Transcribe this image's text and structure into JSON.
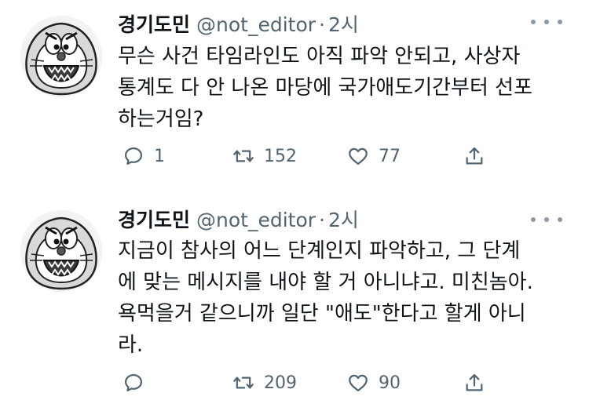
{
  "tweets": [
    {
      "display_name": "경기도민",
      "handle": "@not_editor",
      "separator": "·",
      "time": "2시",
      "lines": [
        "무슨 사건 타임라인도 아직 파악 안되고, 사상자",
        "통계도 다 안 나온 마당에 국가애도기간부터 선포",
        "하는거임?"
      ],
      "replies": "1",
      "retweets": "152",
      "likes": "77"
    },
    {
      "display_name": "경기도민",
      "handle": "@not_editor",
      "separator": "·",
      "time": "2시",
      "lines": [
        "지금이 참사의 어느 단계인지 파악하고, 그 단계",
        "에 맞는 메시지를 내야 할 거 아니냐고. 미친놈아.",
        "욕먹을거 같으니까 일단 \"애도\"한다고 할게 아니",
        "라."
      ],
      "replies": "",
      "retweets": "209",
      "likes": "90"
    }
  ],
  "icons": {
    "avatar": "doraemon-avatar-icon",
    "more": "more-dots-icon",
    "reply": "reply-bubble-icon",
    "retweet": "retweet-icon",
    "like": "heart-icon",
    "share": "share-icon"
  },
  "colors": {
    "text": "#0f1419",
    "secondary": "#536471",
    "more_dots": "#8b98a5"
  }
}
